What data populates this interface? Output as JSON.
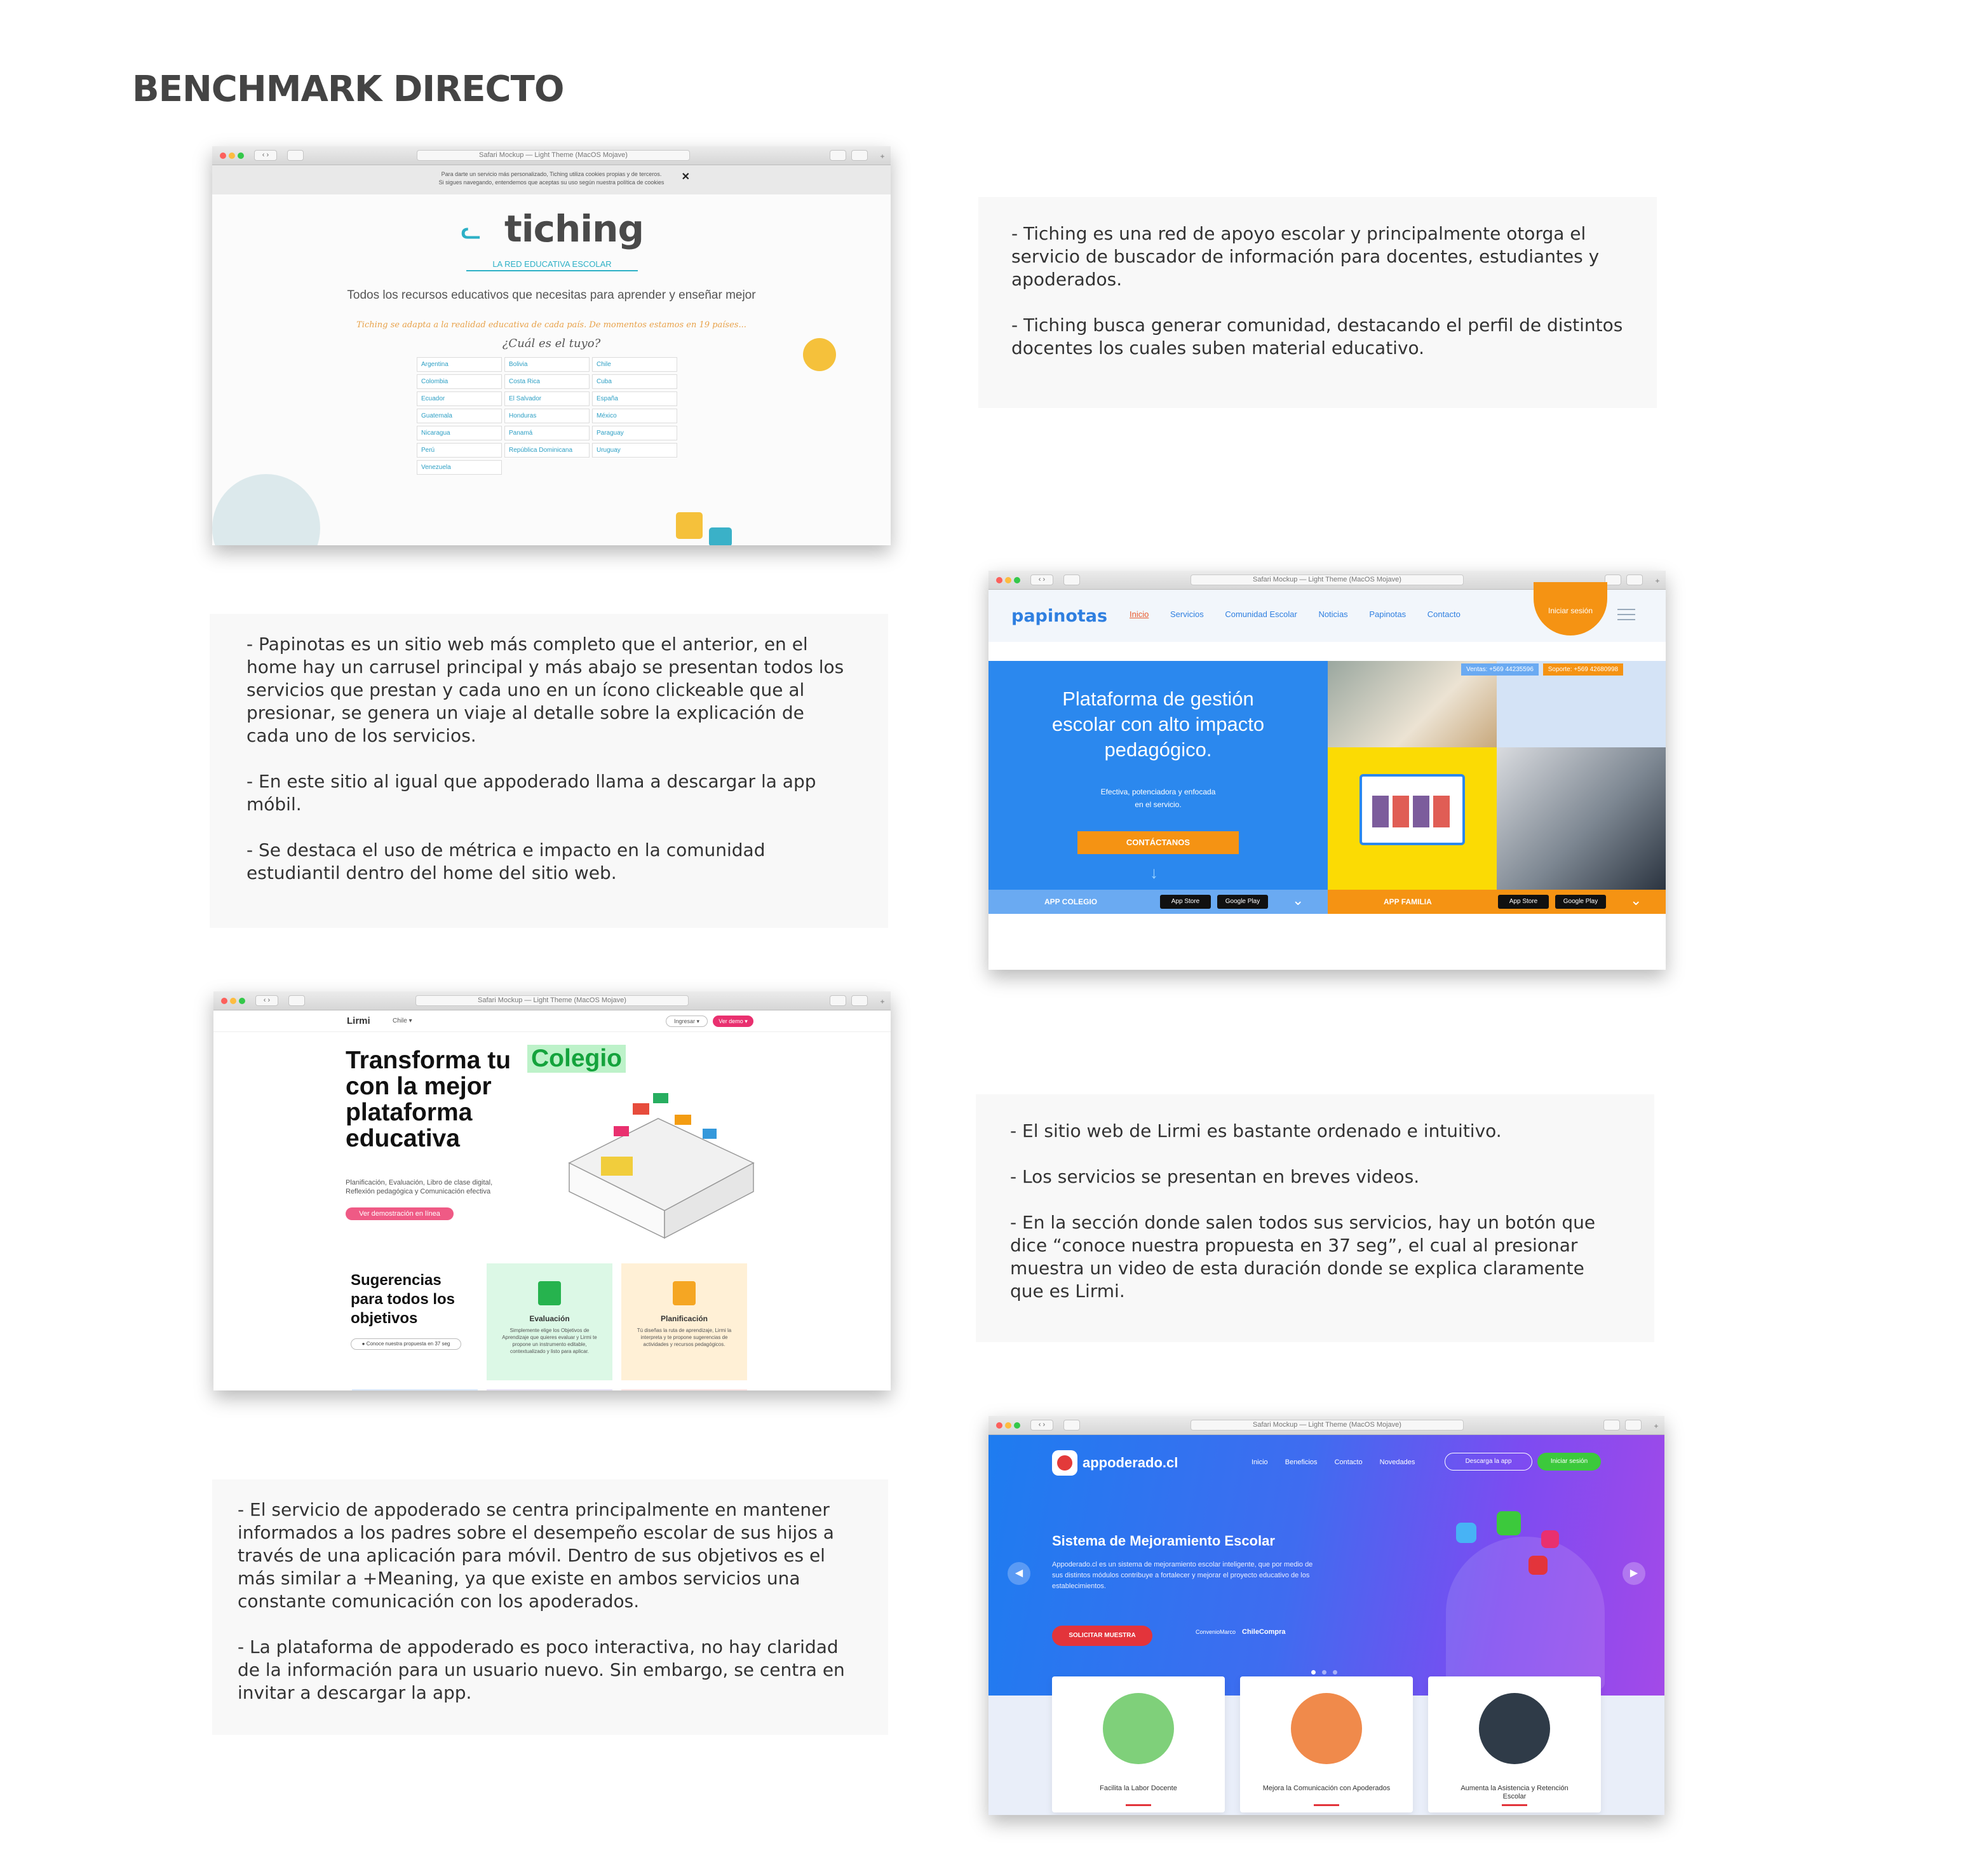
{
  "page_title": "BENCHMARK DIRECTO",
  "browser_url": "Safari Mockup — Light Theme (MacOS Mojave)",
  "tiching": {
    "cookie_line1": "Para darte un servicio más personalizado, Tiching utiliza cookies propias y de terceros.",
    "cookie_line2": "Si sigues navegando, entendemos que aceptas su uso según nuestra política de cookies",
    "close": "✕",
    "logo": "tiching",
    "tagline": "LA RED EDUCATIVA ESCOLAR",
    "headline": "Todos los recursos educativos que necesitas para aprender y enseñar mejor",
    "note": "Tiching se adapta a la realidad educativa de cada país. De momentos estamos en 19 países...",
    "question": "¿Cuál es el tuyo?",
    "countries": [
      "Argentina",
      "Bolivia",
      "Chile",
      "Colombia",
      "Costa Rica",
      "Cuba",
      "Ecuador",
      "El Salvador",
      "España",
      "Guatemala",
      "Honduras",
      "México",
      "Nicaragua",
      "Panamá",
      "Paraguay",
      "Perú",
      "República Dominicana",
      "Uruguay",
      "Venezuela"
    ]
  },
  "tiching_text": {
    "p1": "-     Tiching es una red de apoyo escolar y principalmente otorga el servicio de buscador de información para docentes, estudiantes y apoderados.",
    "p2": "-     Tiching busca generar comunidad, destacando el perfil de distintos docentes los cuales suben material educativo."
  },
  "papinotas_text": {
    "p1": "-     Papinotas es un sitio web más completo que el anterior, en el home hay un carrusel principal y más abajo se presentan todos los servicios que prestan y cada uno en un ícono clickeable que al presionar, se genera un viaje al detalle sobre la explicación de cada uno de los servicios.",
    "p2": "-     En este sitio al igual que appoderado llama a descargar la app móbil.",
    "p3": "-     Se destaca el uso de métrica e impacto en la comunidad estudiantil dentro del home del sitio web."
  },
  "papinotas": {
    "logo": "papinotas",
    "nav": [
      "Inicio",
      "Servicios",
      "Comunidad Escolar",
      "Noticias",
      "Papinotas",
      "Contacto"
    ],
    "login": "Iniciar sesión",
    "phone_sales": "Ventas: +569 44235596",
    "phone_support": "Soporte: +569 42680998",
    "headline": "Plataforma de gestión escolar con alto impacto pedagógico.",
    "sub": "Efectiva, potenciadora y enfocada en el servicio.",
    "cta": "CONTÁCTANOS",
    "app_colegio": "APP COLEGIO",
    "app_familia": "APP FAMILIA",
    "appstore": "App Store",
    "googleplay": "Google Play"
  },
  "lirmi": {
    "logo": "Lirmi",
    "country": "Chile ▾",
    "ingresar": "Ingresar ▾",
    "ver_demo_btn": "Ver demo ▾",
    "headline": "Transforma tu con la mejor plataforma educativa",
    "highlight": "Colegio",
    "desc": "Planificación, Evaluación, Libro de clase digital, Reflexión pedagógica y Comunicación efectiva",
    "demo": "Ver demostración en línea",
    "sugerencias": "Sugerencias para todos los objetivos",
    "pill": "● Conoce nuestra propuesta en 37 seg",
    "card1_title": "Evaluación",
    "card1_desc": "Simplemente elige los Objetivos de Aprendizaje que quieres evaluar y Lirmi te propone un instrumento editable, contextualizado y listo para aplicar.",
    "card2_title": "Planificación",
    "card2_desc": "Tú diseñas la ruta de aprendizaje, Lirmi la interpreta y te propone sugerencias de actividades y recursos pedagógicos."
  },
  "lirmi_text": {
    "p1": "-     El sitio web de Lirmi es bastante ordenado e intuitivo.",
    "p2": "-     Los servicios se presentan en breves videos.",
    "p3": "-     En la sección donde salen todos sus servicios, hay un botón que dice “conoce nuestra propuesta en 37 seg”, el cual al presionar muestra un video de esta duración donde se explica claramente que es Lirmi."
  },
  "appoderado_text": {
    "p1": "-   El servicio de appoderado se centra principalmente en mantener informados a los padres sobre el desempeño escolar de sus hijos a través de una aplicación para móvil. Dentro de sus objetivos es el más similar a +Meaning, ya que existe en ambos servicios una constante comunicación con los apoderados.",
    "p2": "-   La plataforma de appoderado es poco interactiva, no hay claridad de la información para un usuario nuevo. Sin embargo, se centra en invitar a descargar la app."
  },
  "appoderado": {
    "logo": "appoderado.cl",
    "nav": [
      "Inicio",
      "Beneficios",
      "Contacto",
      "Novedades"
    ],
    "download": "Descarga la app",
    "login": "Iniciar sesión",
    "headline": "Sistema de Mejoramiento Escolar",
    "desc": "Appoderado.cl es un sistema de mejoramiento escolar inteligente, que por medio de sus distintos módulos contribuye a fortalecer y mejorar el proyecto educativo de los establecimientos.",
    "cta": "SOLICITAR MUESTRA",
    "partner1": "ConvenioMarco",
    "partner2": "ChileCompra",
    "card1": "Facilita la Labor Docente",
    "card2": "Mejora la Comunicación con Apoderados",
    "card3": "Aumenta la Asistencia y Retención Escolar"
  },
  "colors": {
    "tiching_accent": "#2db0c6",
    "papinotas_blue": "#2b88ee",
    "papinotas_orange": "#f59313",
    "lirmi_pink": "#e9306f",
    "appoderado_red": "#e3343b"
  }
}
